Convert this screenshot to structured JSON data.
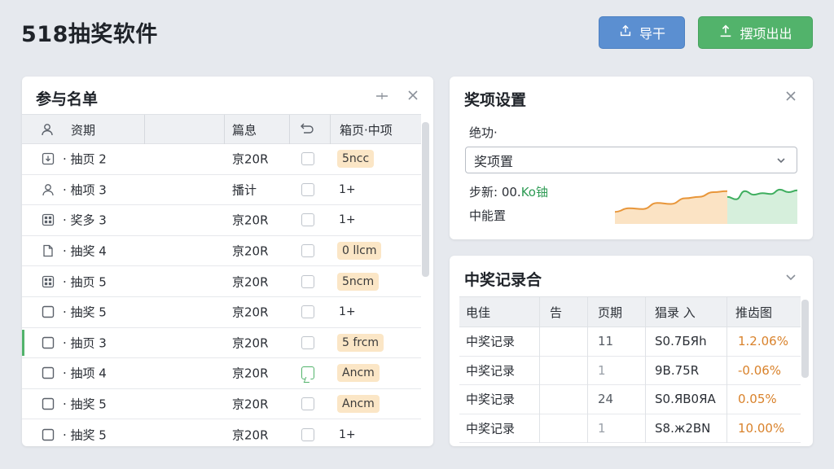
{
  "app": {
    "title": "518抽奖软件"
  },
  "toolbar": {
    "import_label": "导干",
    "export_label": "摆项出出",
    "import_icon": "upload-icon",
    "export_icon": "upload-icon",
    "import_color": "#5b8fd1",
    "export_color": "#52b36b"
  },
  "participants": {
    "title": "参与名单",
    "columns": [
      "资期",
      "篇息",
      "",
      "箱页·中项"
    ],
    "rows": [
      {
        "icon": "download-box-icon",
        "name": "· 抽页 2",
        "value": "亰20R",
        "checked": false,
        "tag": "5ncc",
        "tag_style": "hl"
      },
      {
        "icon": "user-icon",
        "name": "· 柚项 3",
        "value": "播计",
        "checked": false,
        "tag": "1+",
        "tag_style": "plain"
      },
      {
        "icon": "grid-box-icon",
        "name": "· 奖多 3",
        "value": "亰20R",
        "checked": false,
        "tag": "1+",
        "tag_style": "plain"
      },
      {
        "icon": "file-icon",
        "name": "· 抽奖 4",
        "value": "亰20R",
        "checked": false,
        "tag": "0 llcm",
        "tag_style": "hl"
      },
      {
        "icon": "grid-box-icon",
        "name": "· 抽页 5",
        "value": "亰20R",
        "checked": false,
        "tag": "5ncm",
        "tag_style": "hl"
      },
      {
        "icon": "square-icon",
        "name": "· 抽奖 5",
        "value": "亰20R",
        "checked": false,
        "tag": "1+",
        "tag_style": "plain"
      },
      {
        "icon": "square-icon",
        "name": "· 抽页 3",
        "value": "亰20R",
        "checked": false,
        "tag": "5 frcm",
        "tag_style": "hl",
        "selected": true
      },
      {
        "icon": "square-icon",
        "name": "· 抽项 4",
        "value": "亰20R",
        "checked": true,
        "tag": "Ancm",
        "tag_style": "hl"
      },
      {
        "icon": "square-icon",
        "name": "· 抽奖 5",
        "value": "亰20R",
        "checked": false,
        "tag": "Ancm",
        "tag_style": "hl"
      },
      {
        "icon": "square-icon",
        "name": "· 抽奖 5",
        "value": "亰20R",
        "checked": false,
        "tag": "1+",
        "tag_style": "plain"
      }
    ]
  },
  "settings": {
    "title": "奖项设置",
    "field_label": "绝功·",
    "select_value": "奖项置",
    "rate_label": "步新: 00.",
    "rate_value": "Ko铀",
    "status_label": "中能置",
    "spark_orange": [
      0.2,
      0.3,
      0.28,
      0.45,
      0.42,
      0.58,
      0.62,
      0.75,
      0.78
    ],
    "spark_green": [
      0.62,
      0.55,
      0.78,
      0.68,
      0.72,
      0.7,
      0.82,
      0.75,
      0.8
    ]
  },
  "records": {
    "title": "中奖记录合",
    "columns": [
      "电佳",
      "告",
      "页期",
      "猖录 入",
      "推齿图"
    ],
    "rows": [
      {
        "c1": "中奖记录",
        "c2": "",
        "c3": "11",
        "c4": "S0.7БЯh",
        "c5": "1.2.06%"
      },
      {
        "c1": "中奖记录",
        "c2": "",
        "c3": "1",
        "c4": "9B.75R",
        "c5": "-0.06%"
      },
      {
        "c1": "中奖记录",
        "c2": "",
        "c3": "24",
        "c4": "S0.ЯB0ЯA",
        "c5": "0.05%"
      },
      {
        "c1": "中奖记录",
        "c2": "",
        "c3": "1",
        "c4": "S8.ж2BN",
        "c5": "10.00%"
      }
    ]
  }
}
